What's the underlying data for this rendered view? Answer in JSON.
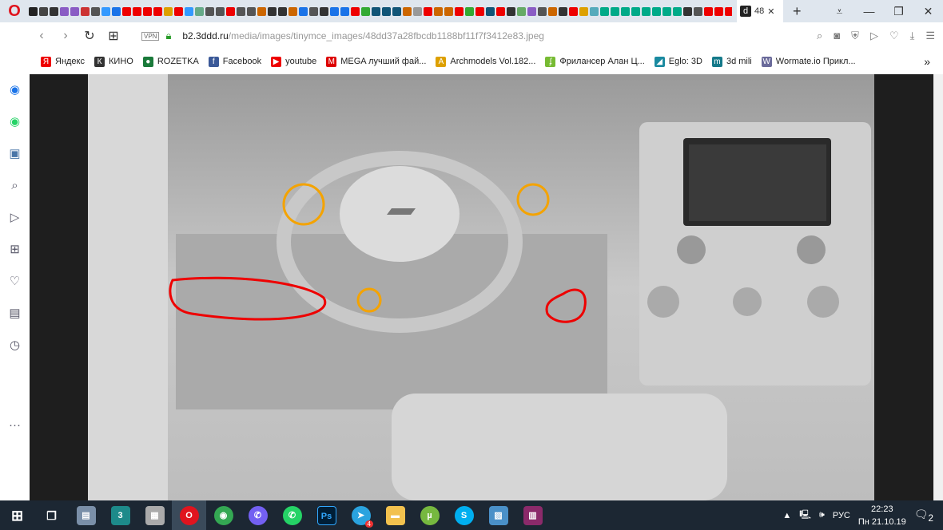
{
  "tabs": {
    "favicon_colors": [
      "#222",
      "#444",
      "#333",
      "#8a5cc4",
      "#8a5cc4",
      "#c33",
      "#555",
      "#39f",
      "#1a73e8",
      "#e00",
      "#e00",
      "#e00",
      "#e00",
      "#dda000",
      "#e00",
      "#39f",
      "#6a8",
      "#555",
      "#555",
      "#e00",
      "#555",
      "#555",
      "#c60",
      "#333",
      "#333",
      "#c60",
      "#1a73e8",
      "#555",
      "#333",
      "#1a73e8",
      "#1a73e8",
      "#e00",
      "#3a3",
      "#157",
      "#157",
      "#157",
      "#c60",
      "#999",
      "#e00",
      "#c60",
      "#c60",
      "#e00",
      "#3a3",
      "#e00",
      "#157",
      "#e00",
      "#333",
      "#6a6",
      "#8a5cc4",
      "#555",
      "#c60",
      "#333",
      "#e00",
      "#dda000",
      "#5ab",
      "#0a8",
      "#0a8",
      "#0a8",
      "#0a8",
      "#0a8",
      "#0a8",
      "#0a8",
      "#0a8",
      "#333",
      "#555",
      "#e00",
      "#e00",
      "#e00",
      "#e00",
      "#dda000",
      "#5a5",
      "#e00",
      "#333",
      "#3a3",
      "#e00",
      "#333"
    ],
    "active_label": "48",
    "active_icon": "d"
  },
  "window": {
    "minimize": "—",
    "restore": "❐",
    "close": "✕",
    "tabmenu": "⩡"
  },
  "address": {
    "vpn": "VPN",
    "url_host": "b2.3ddd.ru",
    "url_path": "/media/images/tinymce_images/48dd37a28fbcdb1188bf11f7f3412e83.jpeg"
  },
  "bookmarks": [
    {
      "label": "Яндекс",
      "icon": "Я",
      "color": "#e00"
    },
    {
      "label": "КИНО",
      "icon": "К",
      "color": "#333"
    },
    {
      "label": "ROZETKA",
      "icon": "●",
      "color": "#1a7a3a"
    },
    {
      "label": "Facebook",
      "icon": "f",
      "color": "#3b5998"
    },
    {
      "label": "youtube",
      "icon": "▶",
      "color": "#e00"
    },
    {
      "label": "MEGA лучший фай...",
      "icon": "M",
      "color": "#d00"
    },
    {
      "label": "Archmodels Vol.182...",
      "icon": "A",
      "color": "#dda000"
    },
    {
      "label": "Фрилансер Алан Ц...",
      "icon": "ʄ",
      "color": "#7b3"
    },
    {
      "label": "Eglo: 3D",
      "icon": "◢",
      "color": "#1a8aa0"
    },
    {
      "label": "3d mili",
      "icon": "m",
      "color": "#157a8a"
    },
    {
      "label": "Wormate.io Прикл...",
      "icon": "W",
      "color": "#6a6a9a"
    }
  ],
  "bookmarks_more": "»",
  "tray": {
    "lang": "РУС",
    "time": "22:23",
    "date": "Пн 21.10.19",
    "notifications": "2",
    "telegram_badge": "4"
  }
}
